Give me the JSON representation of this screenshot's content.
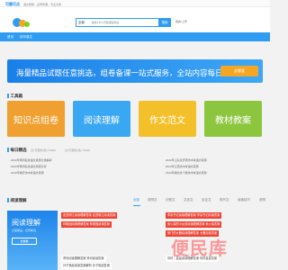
{
  "topbar": {
    "brand": "可圈可点",
    "slogan": "语文题库、名师导课、专业文库"
  },
  "header": {
    "search_select": "全部",
    "search_placeholder": "搜索1.87.3万篇课后作业",
    "search_button": "搜索",
    "upload": "我的/上传"
  },
  "nav": {
    "items": [
      "首页",
      "初中语文"
    ]
  },
  "banner": {
    "text": "海量精品试题任意挑选，组卷备课一站式服务，全站内容每日更新",
    "button": "去看看"
  },
  "tools": {
    "title": "工具箱",
    "items": [
      {
        "label": "知识点组卷",
        "color": "#f0a030"
      },
      {
        "label": "阅读理解",
        "color": "#39a7f2"
      },
      {
        "label": "作文范文",
        "color": "#f4c02a"
      },
      {
        "label": "教材教案",
        "color": "#8cc63f"
      }
    ]
  },
  "daily": {
    "title": "每日精选",
    "tabs": [
      "近7天更新(篇):76060",
      "近7天更新(篇):75228"
    ],
    "list": [
      "2022年黄冈名校语文真题分类解析",
      "2022年山东省济南市中考语文真题",
      "2022年黄冈名校语文真题分析",
      "2022年江西省中考语文真题",
      "2022年重庆市中考语文真题",
      "2022年湖北省十堰市中考语文真题"
    ]
  },
  "reading": {
    "title": "阅读理解",
    "tabs": [
      "全部",
      "说明文",
      "记叙文",
      "文言文",
      "议论文",
      "现代文",
      "阅读技巧",
      "说明"
    ],
    "card_title": "阅读理解",
    "card_subtitle": "全面覆盖，名师精选",
    "card_button": "去看看",
    "rows": [
      "走进明江阅读理解答案 走进明江阅读答案",
      "李泉书记阅读理解答案 李泉书记阅读答案",
      "林徽因阅读理解答案 林徽因阅读答案",
      "卖火柴的小女孩阅读理解答案 卖火柴答案",
      "家门的大雁阅读理解答案 大雁阅读答案",
      "黄河阅读理解答案 黄河阅读答案",
      "你好，星星阅读理解答案 你好星星答案",
      "孙子吴起阅读答案解析 孙子吴起答案"
    ]
  },
  "watermark": "便民库",
  "colors": {
    "accent": "#2f9cf3",
    "orange": "#f5a623"
  }
}
